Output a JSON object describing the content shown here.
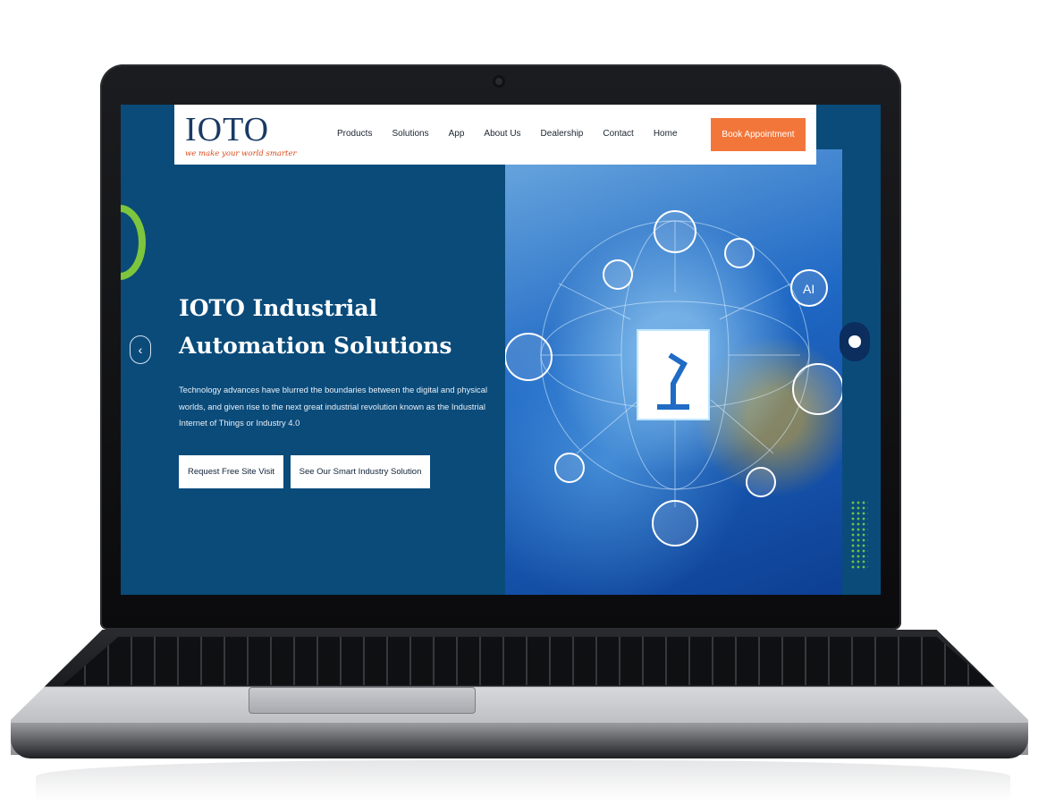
{
  "logo": {
    "text": "IOTO",
    "tagline": "we make your world smarter"
  },
  "nav": {
    "items": [
      "Products",
      "Solutions",
      "App",
      "About Us",
      "Dealership",
      "Contact",
      "Home"
    ],
    "cta": "Book Appointment"
  },
  "hero": {
    "title": "IOTO Industrial Automation Solutions",
    "description": "Technology advances have blurred the boundaries between the digital and physical worlds, and given rise to the next great industrial revolution known as the Industrial Internet of Things or Industry 4.0",
    "buttons": [
      "Request Free Site Visit",
      "See Our Smart Industry Solution"
    ]
  },
  "colors": {
    "hero_bg": "#0a4b7a",
    "accent": "#f2763a",
    "green": "#7dc53d",
    "navy": "#0b2e5e"
  },
  "icons": [
    "wifi-icon",
    "cloud-icon",
    "globe-icon",
    "ai-icon",
    "laptop-icon",
    "robot-arm-icon",
    "factory-icon",
    "gears-icon",
    "chip-icon",
    "worker-icon"
  ]
}
